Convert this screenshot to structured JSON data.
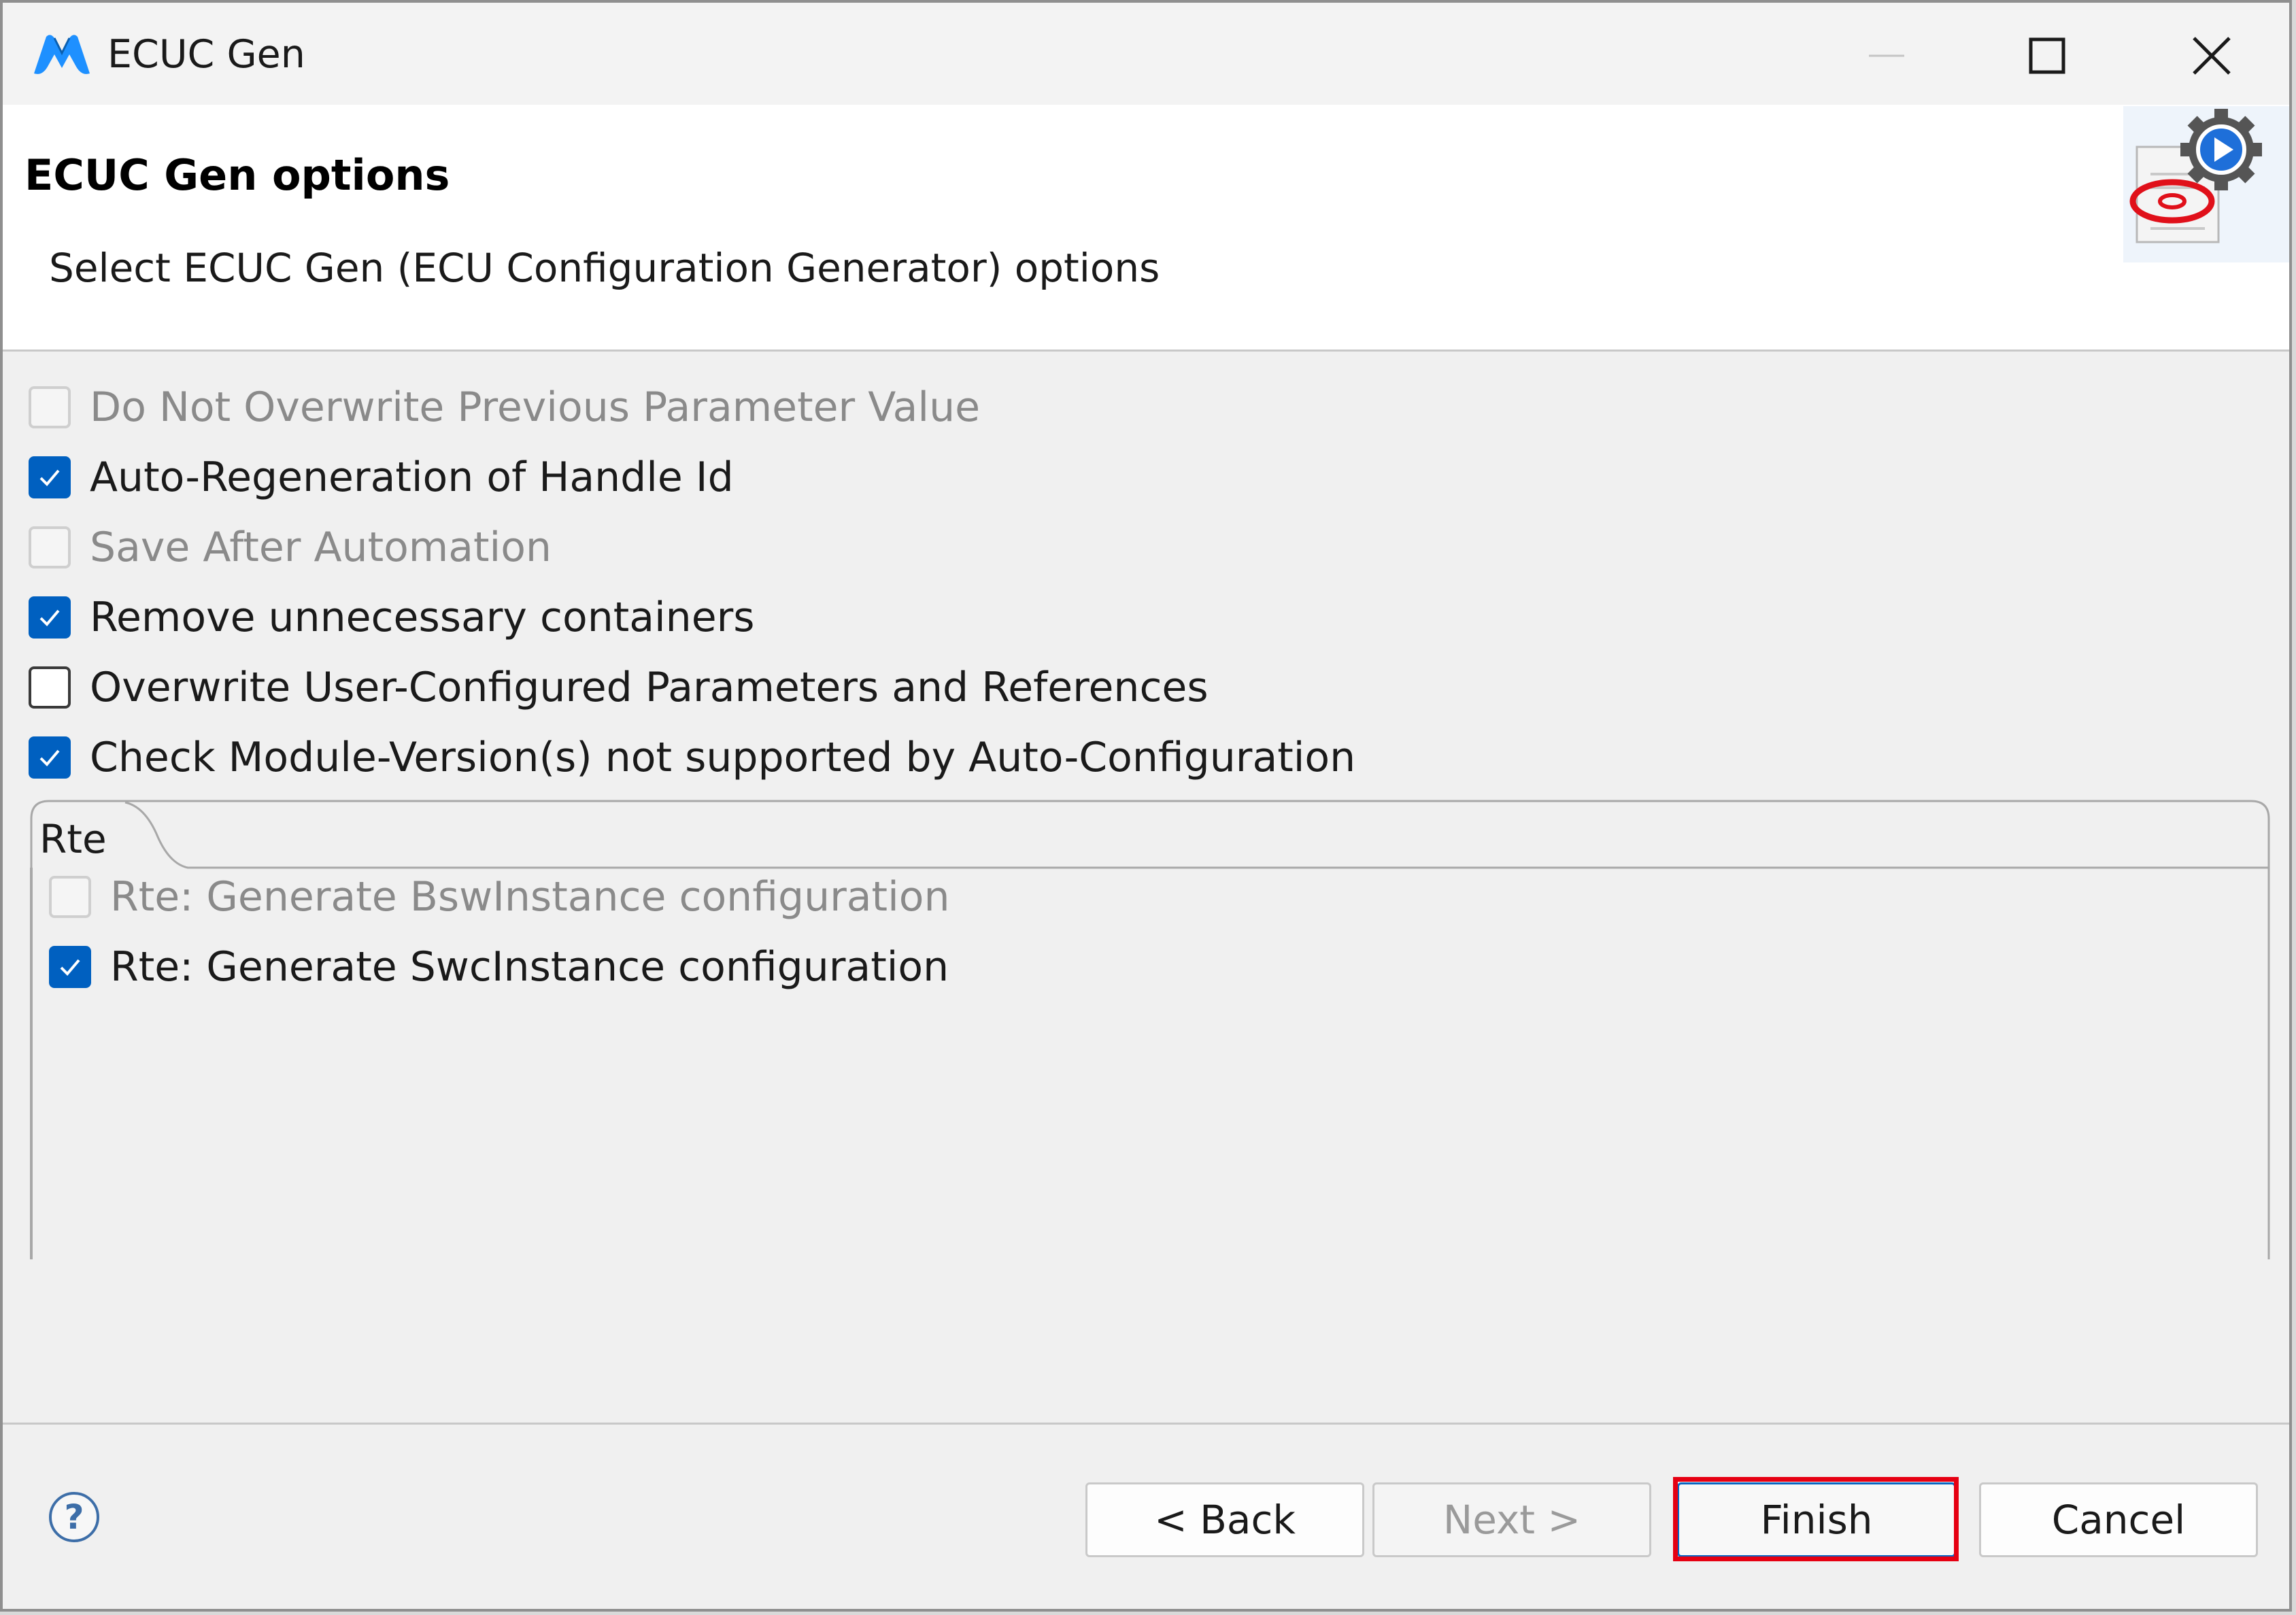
{
  "window": {
    "title": "ECUC Gen"
  },
  "icons": {
    "app": "app-logo-icon",
    "minimize": "minimize-icon",
    "maximize": "maximize-icon",
    "close": "close-icon",
    "header": "wizard-gear-icon",
    "help": "help-icon"
  },
  "header": {
    "title": "ECUC Gen options",
    "description": "Select ECUC Gen (ECU Configuration Generator) options"
  },
  "options": [
    {
      "label": "Do Not Overwrite Previous Parameter Value",
      "checked": false,
      "enabled": false
    },
    {
      "label": "Auto-Regeneration of Handle Id",
      "checked": true,
      "enabled": true
    },
    {
      "label": "Save After Automation",
      "checked": false,
      "enabled": false
    },
    {
      "label": "Remove unnecessary containers",
      "checked": true,
      "enabled": true
    },
    {
      "label": "Overwrite User-Configured Parameters and References",
      "checked": false,
      "enabled": true
    },
    {
      "label": "Check Module-Version(s) not supported by Auto-Configuration",
      "checked": true,
      "enabled": true
    }
  ],
  "tab": {
    "label": "Rte",
    "options": [
      {
        "label": "Rte: Generate BswInstance configuration",
        "checked": false,
        "enabled": false
      },
      {
        "label": "Rte: Generate SwcInstance configuration",
        "checked": true,
        "enabled": true
      }
    ]
  },
  "buttons": {
    "help": "?",
    "back": "< Back",
    "next": "Next >",
    "finish": "Finish",
    "cancel": "Cancel"
  },
  "colors": {
    "accent": "#0060c0",
    "highlight": "#e60012"
  }
}
